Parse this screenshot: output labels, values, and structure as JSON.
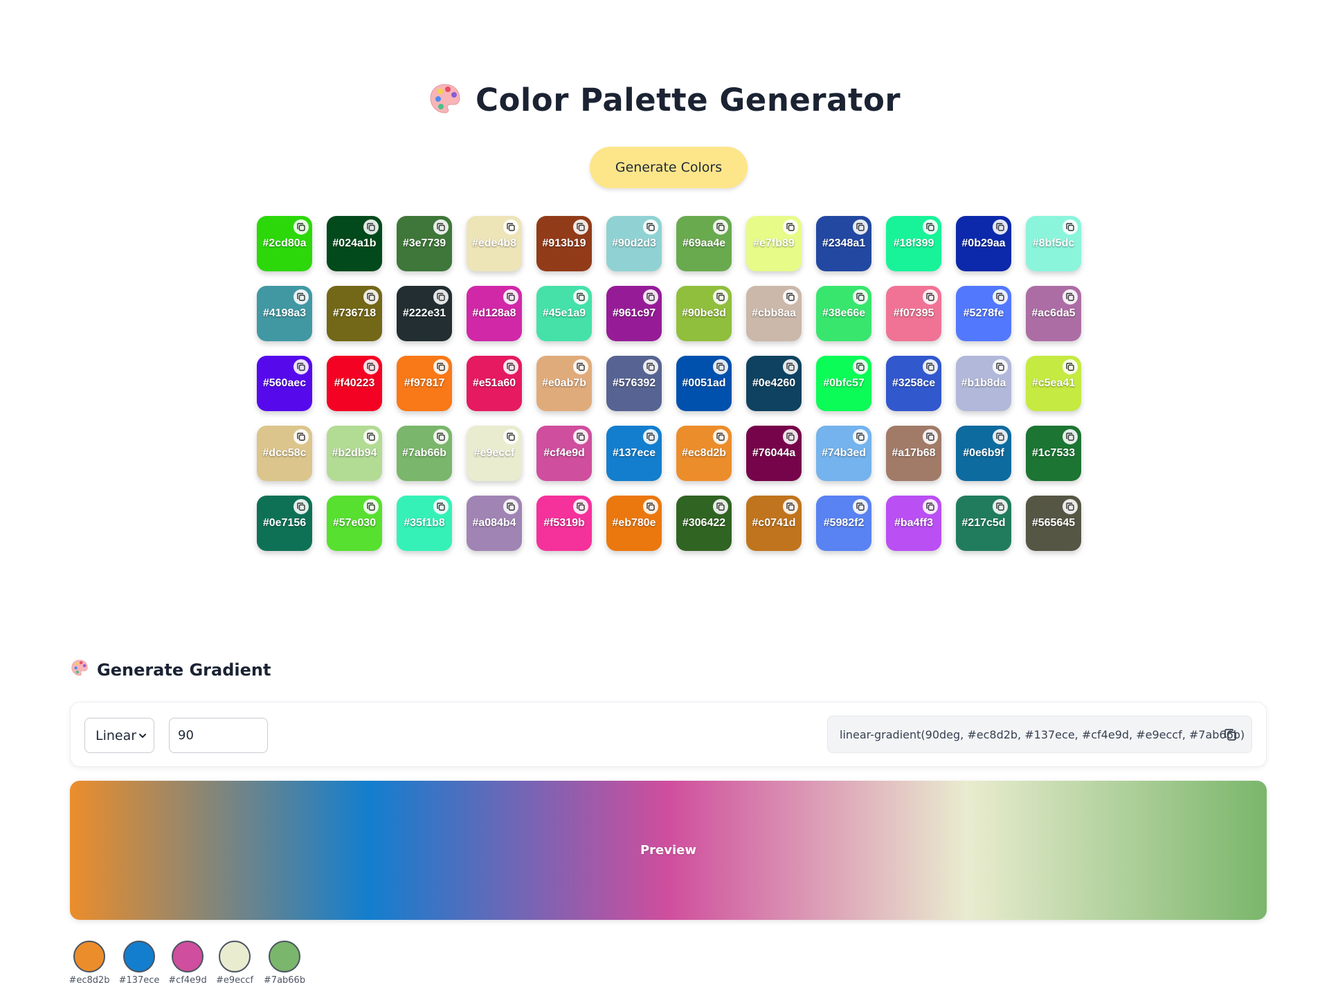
{
  "header": {
    "title": "Color Palette Generator",
    "icon": "palette-icon",
    "generate_label": "Generate Colors",
    "generate_color": "#fde58a"
  },
  "palette": [
    "#2cd80a",
    "#024a1b",
    "#3e7739",
    "#ede4b8",
    "#913b19",
    "#90d2d3",
    "#69aa4e",
    "#e7fb89",
    "#2348a1",
    "#18f399",
    "#0b29aa",
    "#8bf5dc",
    "#4198a3",
    "#736718",
    "#222e31",
    "#d128a8",
    "#45e1a9",
    "#961c97",
    "#90be3d",
    "#cbb8aa",
    "#38e66e",
    "#f07395",
    "#5278fe",
    "#ac6da5",
    "#560aec",
    "#f40223",
    "#f97817",
    "#e51a60",
    "#e0ab7b",
    "#576392",
    "#0051ad",
    "#0e4260",
    "#0bfc57",
    "#3258ce",
    "#b1b8da",
    "#c5ea41",
    "#dcc58c",
    "#b2db94",
    "#7ab66b",
    "#e9eccf",
    "#cf4e9d",
    "#137ece",
    "#ec8d2b",
    "#76044a",
    "#74b3ed",
    "#a17b68",
    "#0e6b9f",
    "#1c7533",
    "#0e7156",
    "#57e030",
    "#35f1b8",
    "#a084b4",
    "#f5319b",
    "#eb780e",
    "#306422",
    "#c0741d",
    "#5982f2",
    "#ba4ff3",
    "#217c5d",
    "#565645"
  ],
  "gradient": {
    "section_title": "Generate Gradient",
    "type": "Linear",
    "type_options": [
      "Linear"
    ],
    "angle": "90",
    "css_output": "linear-gradient(90deg, #ec8d2b, #137ece, #cf4e9d, #e9eccf, #7ab66b)",
    "preview_label": "Preview",
    "stops": [
      "#ec8d2b",
      "#137ece",
      "#cf4e9d",
      "#e9eccf",
      "#7ab66b"
    ]
  }
}
